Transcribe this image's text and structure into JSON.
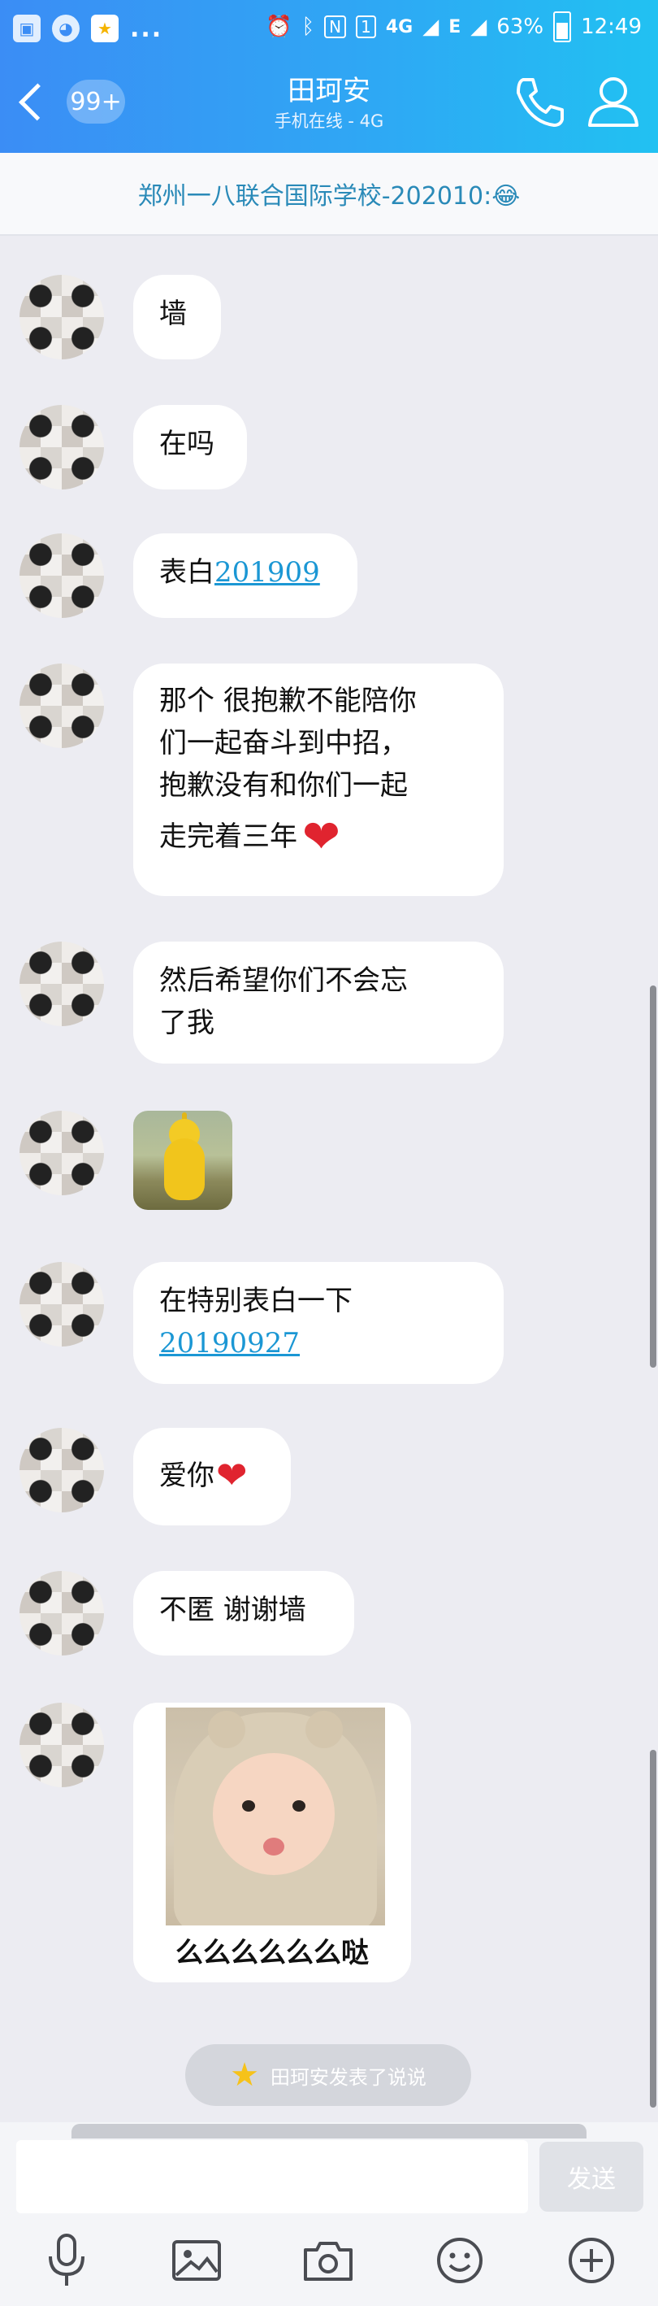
{
  "status_bar": {
    "battery": "63%",
    "time": "12:49",
    "network_1": "4G",
    "network_2": "E",
    "sim": "1",
    "overflow": "..."
  },
  "header": {
    "unread_count": "99+",
    "contact_name": "田珂安",
    "contact_status": "手机在线 - 4G",
    "accent_color": "#2fa7f4"
  },
  "group_banner": "郑州一八联合国际学校-202010:😂",
  "messages": [
    {
      "text": "墙"
    },
    {
      "text": "在吗"
    },
    {
      "text": "表白",
      "link": "201909"
    },
    {
      "line1": "那个 很抱歉不能陪你",
      "line2": "们一起奋斗到中招，",
      "line3": "抱歉没有和你们一起",
      "line4": "走完着三年"
    },
    {
      "line1": "然后希望你们不会忘",
      "line2": "了我"
    },
    {
      "sticker": "teletubby-sticker"
    },
    {
      "line1": "在特别表白一下",
      "link": "20190927"
    },
    {
      "text": "爱你"
    },
    {
      "text": "不匿 谢谢墙"
    },
    {
      "sticker_caption": "么么么么么么哒"
    }
  ],
  "status_pill": "田珂安发表了说说",
  "input": {
    "placeholder": "",
    "send_label": "发送"
  },
  "toolbar_icons": [
    "microphone-icon",
    "image-icon",
    "camera-icon",
    "emoji-icon",
    "plus-icon"
  ]
}
